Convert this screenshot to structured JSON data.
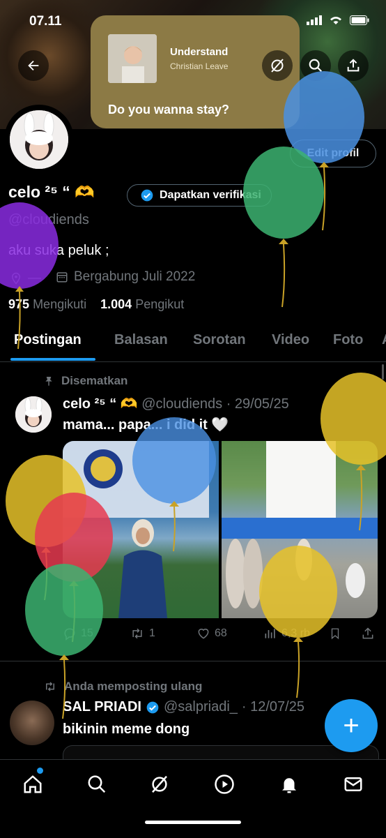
{
  "status": {
    "time": "07.11"
  },
  "music": {
    "title": "Understand",
    "artist": "Christian Leave",
    "lyric": "Do you wanna stay?"
  },
  "profile": {
    "edit_label": "Edit profil",
    "name": "celo ²⁵ “",
    "verify_label": "Dapatkan verifikasi",
    "handle": "@cloudiends",
    "bio": "aku suka peluk ;",
    "location": "—",
    "joined": "Bergabung Juli 2022",
    "following_count": "975",
    "following_label": "Mengikuti",
    "followers_count": "1.004",
    "followers_label": "Pengikut"
  },
  "tabs": [
    "Postingan",
    "Balasan",
    "Sorotan",
    "Video",
    "Foto",
    "A"
  ],
  "pinned_post": {
    "pinned_label": "Disematkan",
    "author": "celo ²⁵ “",
    "handle": "@cloudiends",
    "date": "· 29/05/25",
    "text": "mama... papa... i did it 🤍",
    "replies": "15",
    "reposts": "1",
    "likes": "68",
    "views": "6,3 rb"
  },
  "repost": {
    "label": "Anda memposting ulang",
    "author": "SAL PRIADI",
    "handle": "@salpriadi_",
    "date": "· 12/07/25",
    "text": "bikinin meme dong"
  },
  "fab_label": "+",
  "icons": {
    "back": "back-arrow-icon",
    "grok": "grok-icon",
    "search": "search-icon",
    "share": "share-icon",
    "verified": "verified-badge-icon",
    "location": "location-icon",
    "calendar": "calendar-icon",
    "pin": "pin-icon",
    "reply": "reply-icon",
    "retweet": "retweet-icon",
    "like": "heart-icon",
    "views": "views-icon",
    "bookmark": "bookmark-icon",
    "home": "home-icon",
    "bell": "bell-icon",
    "mail": "mail-icon",
    "play": "play-icon"
  },
  "colors": {
    "accent": "#1d9bf0",
    "muted": "#71767b",
    "music_card": "#8c7a45"
  }
}
